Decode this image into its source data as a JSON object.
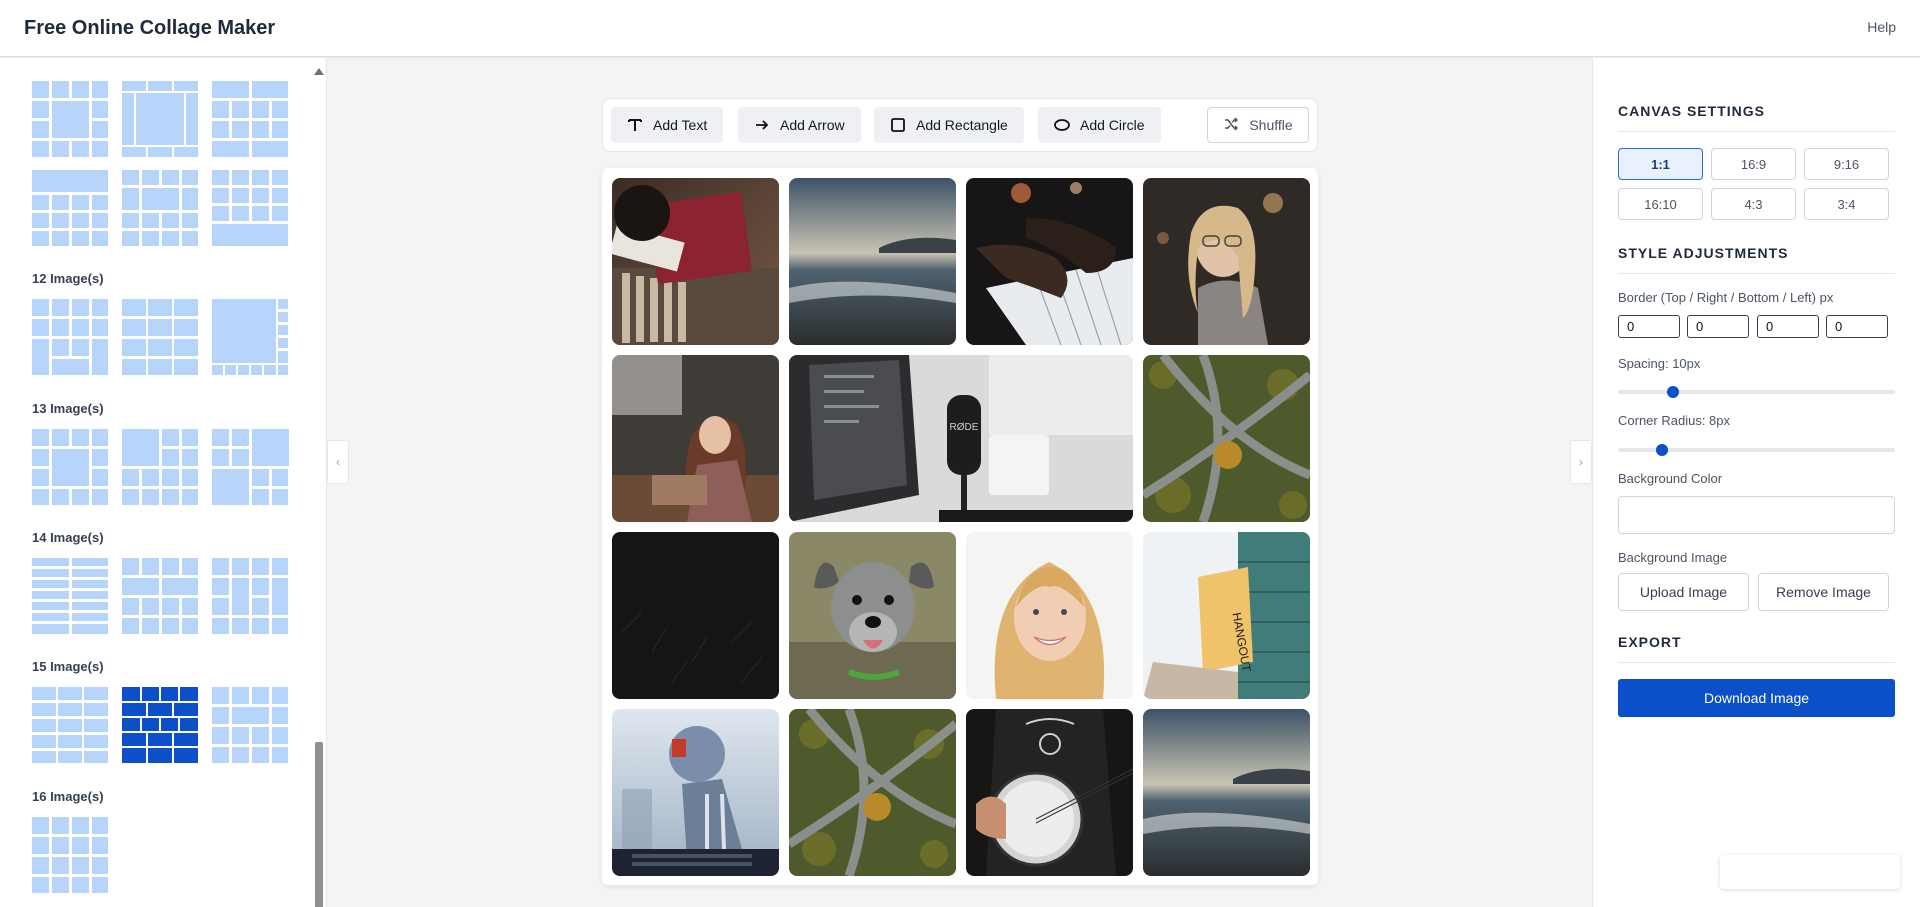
{
  "header": {
    "title": "Free Online Collage Maker",
    "help_label": "Help"
  },
  "layouts": {
    "groups": [
      {
        "label": "12 Image(s)"
      },
      {
        "label": "13 Image(s)"
      },
      {
        "label": "14 Image(s)"
      },
      {
        "label": "15 Image(s)"
      },
      {
        "label": "16 Image(s)"
      }
    ]
  },
  "toolbar": {
    "add_text": "Add Text",
    "add_arrow": "Add Arrow",
    "add_rectangle": "Add Rectangle",
    "add_circle": "Add Circle",
    "shuffle": "Shuffle"
  },
  "settings": {
    "canvas_title": "CANVAS SETTINGS",
    "ratios": [
      "1:1",
      "16:9",
      "9:16",
      "16:10",
      "4:3",
      "3:4"
    ],
    "selected_ratio": "1:1",
    "style_title": "STYLE ADJUSTMENTS",
    "border_label": "Border (Top / Right / Bottom / Left) px",
    "border_values": [
      "0",
      "0",
      "0",
      "0"
    ],
    "spacing_label": "Spacing: 10px",
    "spacing_fraction": 0.2,
    "radius_label": "Corner Radius: 8px",
    "radius_fraction": 0.16,
    "bg_color_label": "Background Color",
    "bg_image_label": "Background Image",
    "upload_label": "Upload Image",
    "remove_label": "Remove Image",
    "export_title": "EXPORT",
    "download_label": "Download Image"
  },
  "colors": {
    "accent": "#0b4fc9",
    "thumb": "#b7d4fa"
  }
}
